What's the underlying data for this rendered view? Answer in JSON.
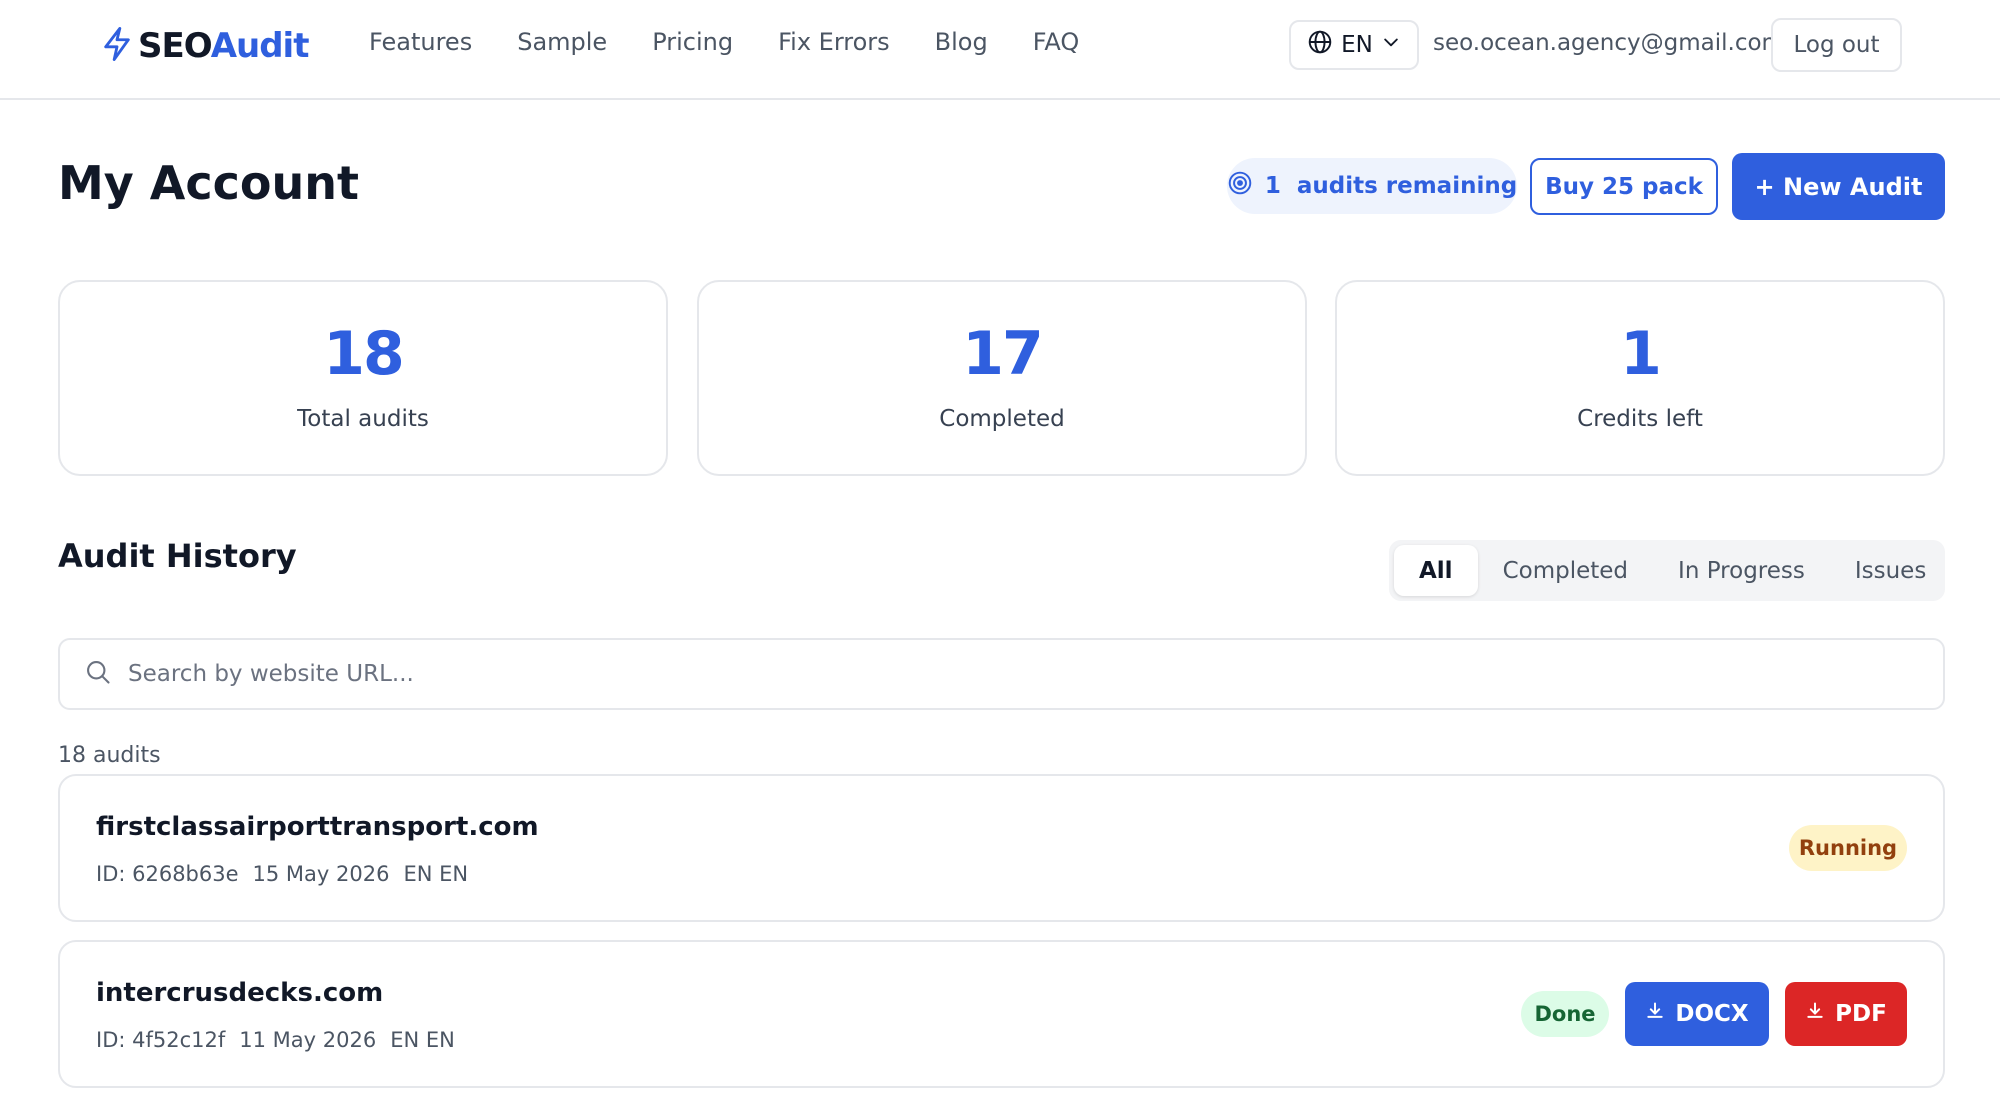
{
  "header": {
    "logo": {
      "part1": "SEO",
      "part2": "Audit"
    },
    "nav": [
      "Features",
      "Sample",
      "Pricing",
      "Fix Errors",
      "Blog",
      "FAQ"
    ],
    "language": "EN",
    "user_email": "seo.ocean.agency@gmail.com",
    "logout_label": "Log out"
  },
  "account": {
    "title": "My Account",
    "remaining": "1  audits remaining",
    "buy_label": "Buy 25 pack",
    "new_audit_label": "+ New Audit"
  },
  "stats": [
    {
      "value": "18",
      "label": "Total audits"
    },
    {
      "value": "17",
      "label": "Completed"
    },
    {
      "value": "1",
      "label": "Credits left"
    }
  ],
  "history": {
    "title": "Audit History",
    "tabs": [
      "All",
      "Completed",
      "In Progress",
      "Issues"
    ],
    "active_tab": "All",
    "search_placeholder": "Search by website URL...",
    "count_label": "18 audits",
    "audits": [
      {
        "domain": "firstclassairporttransport.com",
        "id": "ID: 6268b63e",
        "date": "15 May 2026",
        "lang": "EN EN",
        "status": "Running"
      },
      {
        "domain": "intercrusdecks.com",
        "id": "ID: 4f52c12f",
        "date": "11 May 2026",
        "lang": "EN EN",
        "status": "Done",
        "docx_label": "DOCX",
        "pdf_label": "PDF"
      }
    ]
  },
  "colors": {
    "accent": "#2f5fde",
    "running_bg": "#fef3c7",
    "running_text": "#92400e",
    "done_bg": "#dcfce7",
    "done_text": "#166534",
    "pdf": "#dc2626"
  },
  "icons": {
    "logo": "lightning-bolt-icon",
    "language": "globe-icon",
    "dropdown": "chevron-down-icon",
    "remaining": "target-icon",
    "search": "search-icon",
    "download": "download-icon"
  }
}
